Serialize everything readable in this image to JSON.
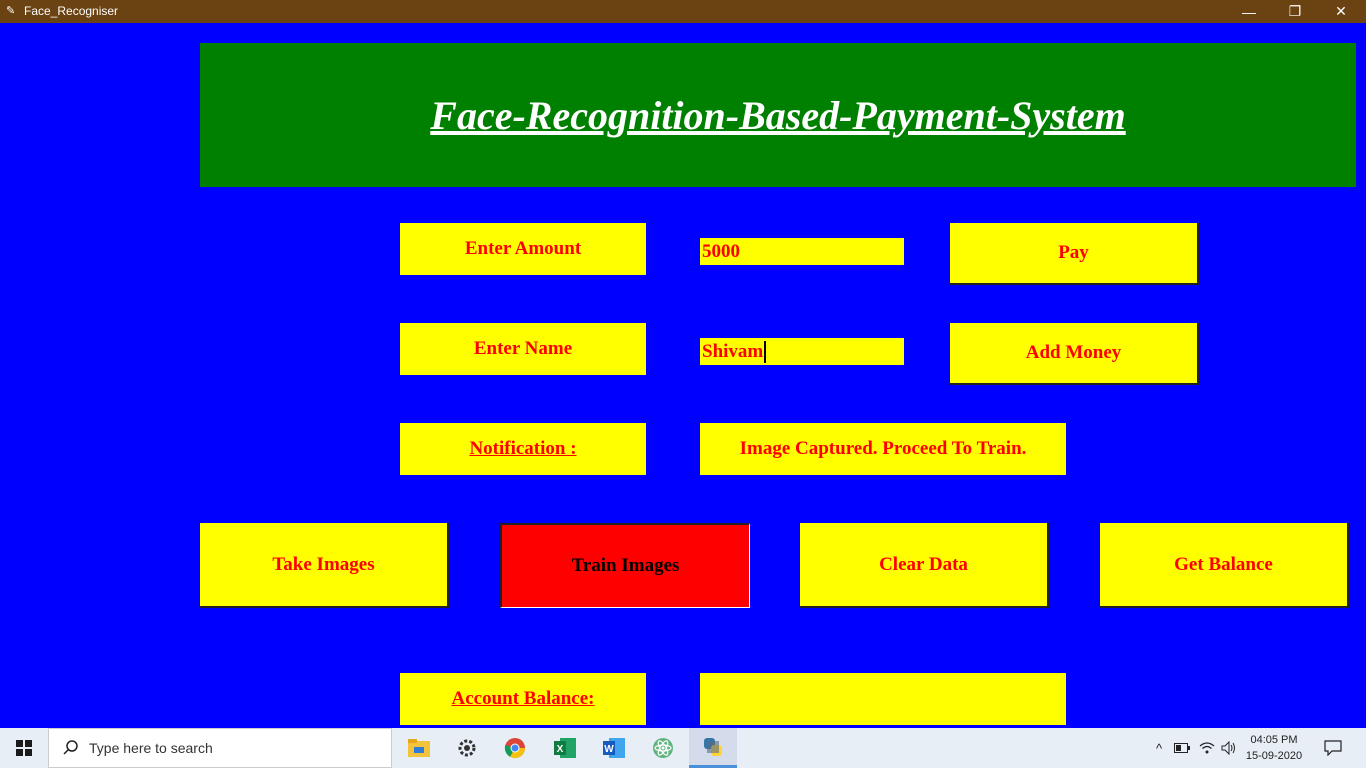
{
  "window": {
    "title": "Face_Recogniser",
    "minimize_glyph": "—",
    "maximize_glyph": "❐",
    "close_glyph": "✕"
  },
  "header": {
    "title": "Face-Recognition-Based-Payment-System"
  },
  "form": {
    "amount_label": "Enter Amount",
    "amount_value": "5000",
    "pay_button": "Pay",
    "name_label": "Enter Name",
    "name_value": "Shivam",
    "add_money_button": "Add Money",
    "notification_label": "Notification : ",
    "notification_message": "Image Captured. Proceed To Train."
  },
  "actions": {
    "take_images": "Take Images",
    "train_images": "Train Images",
    "clear_data": "Clear Data",
    "get_balance": "Get Balance"
  },
  "balance": {
    "label": "Account Balance: ",
    "value": ""
  },
  "colors": {
    "background": "#0000ff",
    "header": "#008000",
    "box": "#ffff00",
    "text": "#ff0000",
    "active_button": "#ff0000",
    "titlebar": "#6b4212"
  },
  "taskbar": {
    "search_placeholder": "Type here to search",
    "time": "04:05 PM",
    "date": "15-09-2020",
    "apps": [
      "file-explorer-icon",
      "settings-icon",
      "chrome-icon",
      "excel-icon",
      "word-icon",
      "atom-icon",
      "python-icon"
    ]
  }
}
